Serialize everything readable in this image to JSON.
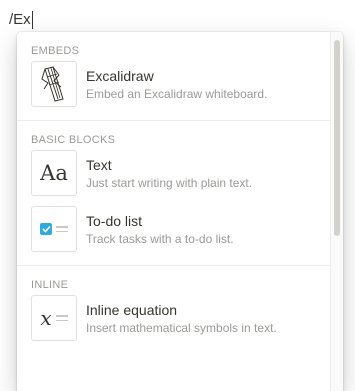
{
  "editor": {
    "typed_text": "/Ex"
  },
  "menu": {
    "sections": [
      {
        "header": "EMBEDS",
        "items": [
          {
            "title": "Excalidraw",
            "description": "Embed an Excalidraw whiteboard.",
            "icon": "excalidraw-icon"
          }
        ]
      },
      {
        "header": "BASIC BLOCKS",
        "items": [
          {
            "title": "Text",
            "description": "Just start writing with plain text.",
            "icon": "text-aa-icon",
            "glyph": "Aa"
          },
          {
            "title": "To-do list",
            "description": "Track tasks with a to-do list.",
            "icon": "todo-checkbox-icon"
          }
        ]
      },
      {
        "header": "INLINE",
        "items": [
          {
            "title": "Inline equation",
            "description": "Insert mathematical symbols in text.",
            "icon": "equation-icon",
            "glyph": "x"
          }
        ]
      }
    ]
  },
  "colors": {
    "accent": "#2eaadc",
    "text": "#37352f",
    "muted": "#9b9a97"
  }
}
